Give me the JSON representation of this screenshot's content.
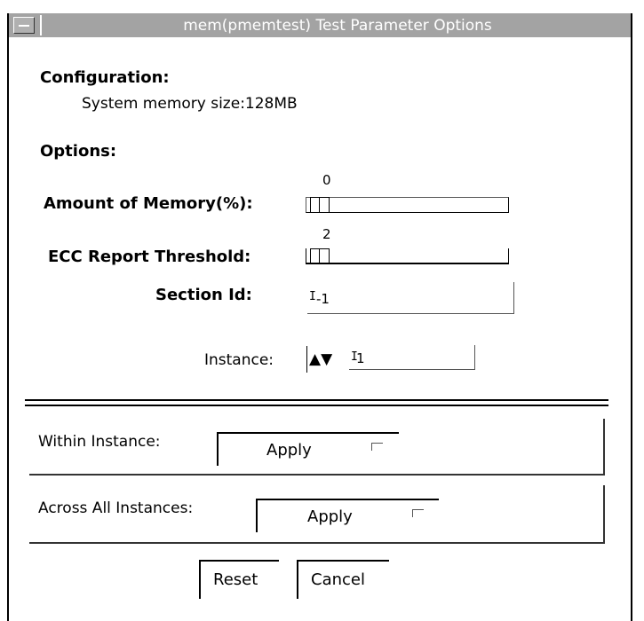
{
  "window": {
    "title": "mem(pmemtest) Test Parameter Options"
  },
  "configuration": {
    "heading": "Configuration:",
    "memory_label": "System memory size:128MB"
  },
  "options": {
    "heading": "Options:",
    "amount": {
      "label": "Amount of Memory(%):",
      "value": "0"
    },
    "ecc": {
      "label": "ECC Report Threshold:",
      "value": "2"
    },
    "section": {
      "label": "Section Id:",
      "value": "-1"
    },
    "instance": {
      "label": "Instance:",
      "value": "1",
      "arrows": "▲▼"
    }
  },
  "within": {
    "label": "Within Instance:",
    "apply": "Apply"
  },
  "across": {
    "label": "Across All Instances:",
    "apply": "Apply"
  },
  "buttons": {
    "reset": "Reset",
    "cancel": "Cancel"
  }
}
